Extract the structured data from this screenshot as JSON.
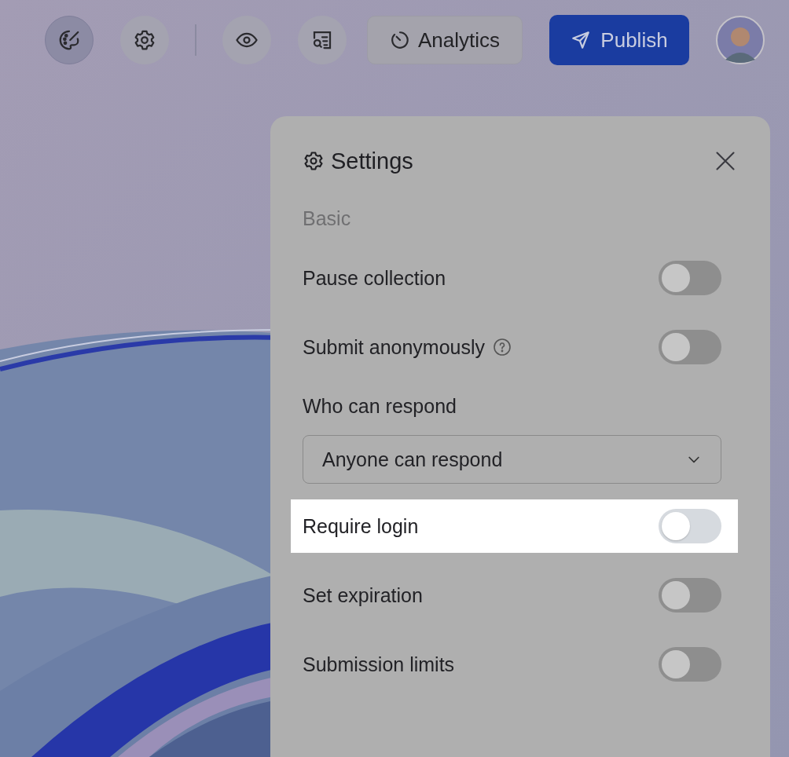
{
  "toolbar": {
    "icon_groups": [
      [
        {
          "kind": "palette",
          "selected": true
        },
        {
          "kind": "gear",
          "selected": false
        }
      ],
      [
        {
          "kind": "eye",
          "selected": false
        },
        {
          "kind": "search-list",
          "selected": false
        }
      ]
    ],
    "analytics_button": {
      "label": "Analytics"
    },
    "publish_button": {
      "label": "Publish"
    }
  },
  "settings_panel": {
    "title": "Settings",
    "section": "Basic",
    "rows": [
      {
        "kind": "toggle",
        "label": "Pause collection",
        "on": false,
        "help": false,
        "highlighted": false
      },
      {
        "kind": "toggle",
        "label": "Submit anonymously",
        "on": false,
        "help": true,
        "highlighted": false
      },
      {
        "kind": "select",
        "label": "Who can respond",
        "value": "Anyone can respond",
        "highlighted": false
      },
      {
        "kind": "toggle",
        "label": "Require login",
        "on": false,
        "help": false,
        "highlighted": true
      },
      {
        "kind": "toggle",
        "label": "Set expiration",
        "on": false,
        "help": false,
        "highlighted": false
      },
      {
        "kind": "toggle",
        "label": "Submission limits",
        "on": false,
        "help": false,
        "highlighted": false
      }
    ]
  }
}
